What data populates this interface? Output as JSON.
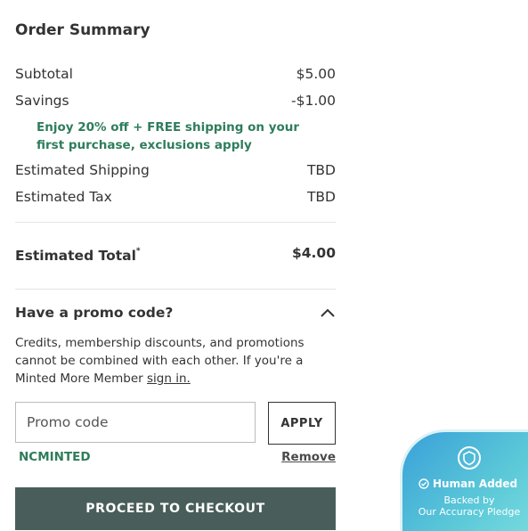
{
  "order_summary": {
    "title": "Order Summary",
    "subtotal_label": "Subtotal",
    "subtotal_value": "$5.00",
    "savings_label": "Savings",
    "savings_value": "-$1.00",
    "promo_message": "Enjoy 20% off + FREE shipping on your first purchase, exclusions apply",
    "shipping_label": "Estimated Shipping",
    "shipping_value": "TBD",
    "tax_label": "Estimated Tax",
    "tax_value": "TBD",
    "total_label": "Estimated Total",
    "total_marker": "*",
    "total_value": "$4.00"
  },
  "promo": {
    "heading": "Have a promo code?",
    "expanded": true,
    "description": "Credits, membership discounts, and promotions cannot be combined with each other. If you're a Minted More Member",
    "sign_in_link": "sign in.",
    "input_placeholder": "Promo code",
    "input_value": "",
    "apply_label": "APPLY",
    "applied_code": "NCMINTED",
    "remove_label": "Remove"
  },
  "checkout": {
    "button_label": "PROCEED TO CHECKOUT"
  },
  "badge": {
    "headline": "Human Added",
    "sub_line1": "Backed by",
    "sub_line2": "Our Accuracy Pledge",
    "icon": "shield-check-icon"
  },
  "colors": {
    "accent_green": "#2e7d5b",
    "checkout_bg": "#495e5a",
    "badge_gradient_start": "#3aa0d9",
    "badge_gradient_end": "#7fe0e0"
  }
}
